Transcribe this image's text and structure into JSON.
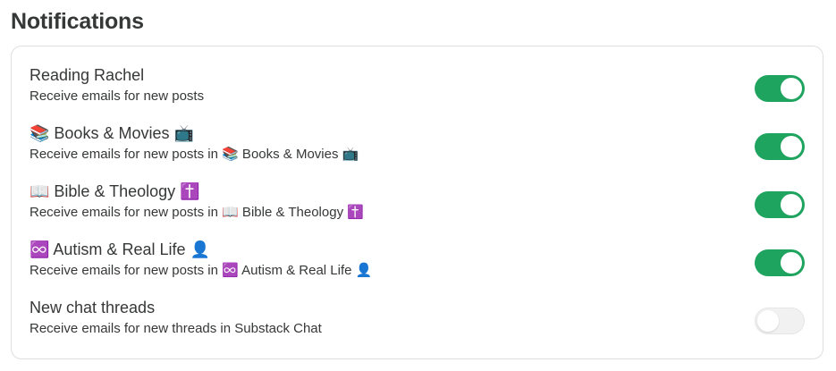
{
  "section": {
    "title": "Notifications"
  },
  "colors": {
    "toggle_on": "#1fa45f",
    "toggle_off": "#f1f1f1"
  },
  "rows": [
    {
      "title": "Reading Rachel",
      "description": "Receive emails for new posts",
      "enabled": true
    },
    {
      "title": "📚 Books & Movies 📺",
      "description": "Receive emails for new posts in 📚 Books & Movies 📺",
      "enabled": true
    },
    {
      "title": "📖 Bible & Theology ✝️",
      "description": "Receive emails for new posts in 📖 Bible & Theology ✝️",
      "enabled": true
    },
    {
      "title": "♾️ Autism & Real Life 👤",
      "description": "Receive emails for new posts in ♾️ Autism & Real Life 👤",
      "enabled": true
    },
    {
      "title": "New chat threads",
      "description": "Receive emails for new threads in Substack Chat",
      "enabled": false
    }
  ]
}
